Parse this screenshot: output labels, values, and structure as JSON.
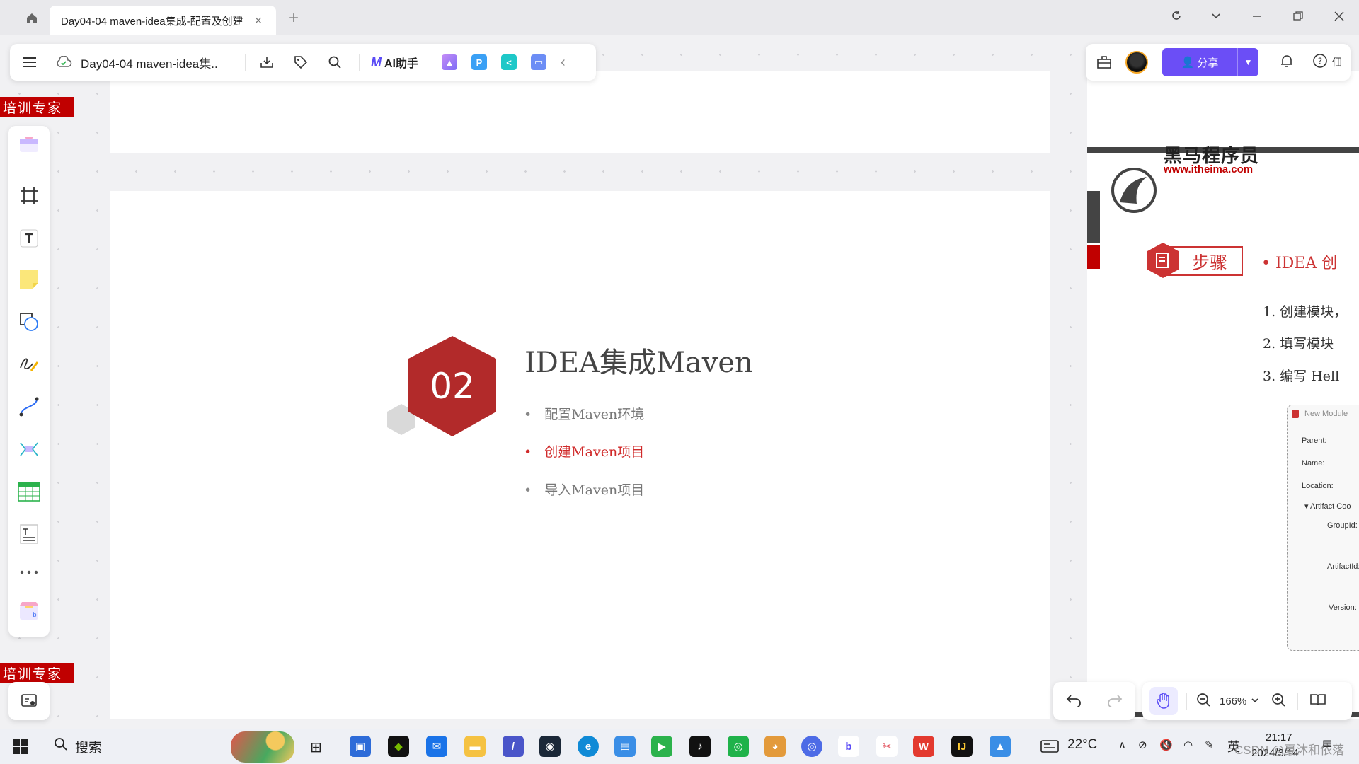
{
  "browser": {
    "tab_title": "Day04-04 maven-idea集成-配置及创建",
    "tab_close": "×",
    "new_tab": "+"
  },
  "toolbar": {
    "doc_title": "Day04-04 maven-idea集..",
    "ai_label": "AI助手",
    "collapse": "‹"
  },
  "topright": {
    "share_label": "分享",
    "clip_text": "佃"
  },
  "labels": {
    "trainer_top": "培训专家",
    "trainer_bottom": "培训专家"
  },
  "slide": {
    "number": "02",
    "title": "IDEA集成Maven",
    "bullets": [
      {
        "text": "配置Maven环境",
        "active": false
      },
      {
        "text": "创建Maven项目",
        "active": true
      },
      {
        "text": "导入Maven项目",
        "active": false
      }
    ]
  },
  "right_slide": {
    "logo_name": "黑马程序员",
    "logo_url": "www.itheima.com",
    "steps_label": "步骤",
    "idea_line": "•   IDEA 创",
    "steps": [
      "1.  创建模块，",
      "2.  填写模块",
      "3.  编写 Hell"
    ],
    "dialog": {
      "title": "New Module",
      "fields": [
        "Parent:",
        "Name:",
        "Location:",
        "▾ Artifact Coo",
        "GroupId:",
        "ArtifactId:",
        "Version:"
      ]
    }
  },
  "zoom": {
    "value": "166%"
  },
  "taskbar": {
    "search_placeholder": "搜索",
    "weather": "22°C",
    "ime": "英",
    "time": "21:17",
    "date": "2024/3/14",
    "watermark": "CSDN @夏沐和依落"
  },
  "colors": {
    "accent": "#6b4ef6",
    "slide_red": "#b22a2a",
    "label_red": "#c00000"
  }
}
